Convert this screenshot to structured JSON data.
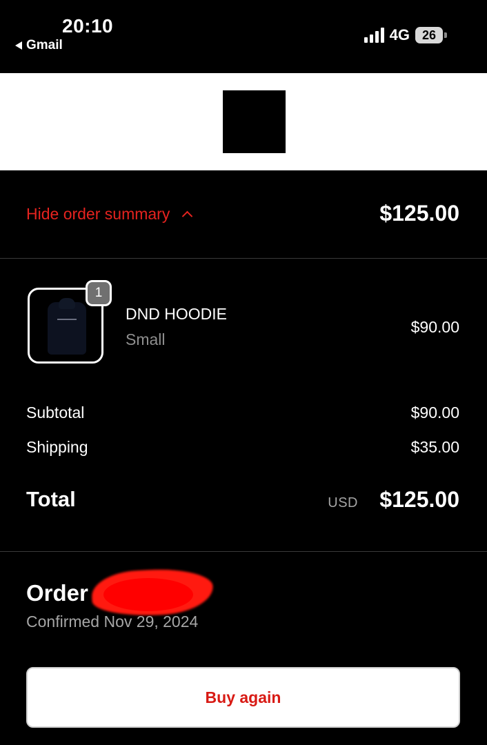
{
  "status_bar": {
    "time": "20:10",
    "back_app": "Gmail",
    "network": "4G",
    "battery": "26"
  },
  "summary": {
    "toggle_label": "Hide order summary",
    "total": "$125.00"
  },
  "line_item": {
    "quantity": "1",
    "name": "DND HOODIE",
    "variant": "Small",
    "price": "$90.00"
  },
  "totals": {
    "subtotal_label": "Subtotal",
    "subtotal_value": "$90.00",
    "shipping_label": "Shipping",
    "shipping_value": "$35.00",
    "total_label": "Total",
    "currency": "USD",
    "total_value": "$125.00"
  },
  "order": {
    "title": "Order",
    "confirmed": "Confirmed Nov 29, 2024"
  },
  "actions": {
    "buy_again": "Buy again"
  },
  "colors": {
    "accent_red": "#e5231f",
    "background": "#000000"
  }
}
